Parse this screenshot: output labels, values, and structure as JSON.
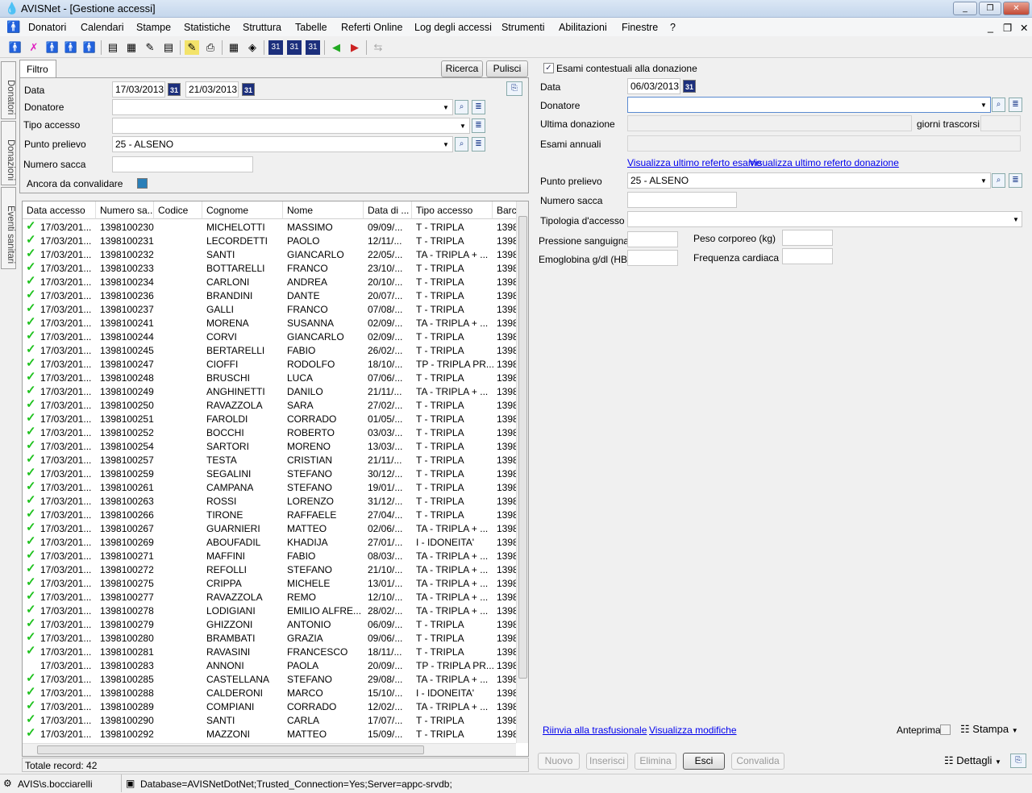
{
  "window": {
    "title": "AVISNet - [Gestione accessi]"
  },
  "menu": [
    "Donatori",
    "Calendari",
    "Stampe",
    "Statistiche",
    "Struttura",
    "Tabelle",
    "Referti Online",
    "Log degli accessi",
    "Strumenti",
    "Abilitazioni",
    "Finestre",
    "?"
  ],
  "side_tabs": [
    "Donatori",
    "Donazioni",
    "Eventi sanitari"
  ],
  "filter": {
    "tab": "Filtro",
    "search": "Ricerca",
    "clear": "Pulisci",
    "data_label": "Data",
    "date_from": "17/03/2013",
    "date_to": "21/03/2013",
    "donatore_label": "Donatore",
    "donatore_value": "",
    "tipo_label": "Tipo accesso",
    "tipo_value": "",
    "punto_label": "Punto prelievo",
    "punto_value": "25 -  ALSENO",
    "sacca_label": "Numero sacca",
    "sacca_value": "",
    "convalidare_label": "Ancora da convalidare"
  },
  "grid": {
    "columns": [
      "Data accesso",
      "Numero sa...",
      "Codice",
      "Cognome",
      "Nome",
      "Data di ...",
      "Tipo accesso",
      "Barc"
    ],
    "rows": [
      [
        true,
        "17/03/201...",
        "1398100230",
        "",
        "MICHELOTTI",
        "MASSIMO",
        "09/09/...",
        "T - TRIPLA",
        "1398"
      ],
      [
        true,
        "17/03/201...",
        "1398100231",
        "",
        "LECORDETTI",
        "PAOLO",
        "12/11/...",
        "T - TRIPLA",
        "1398"
      ],
      [
        true,
        "17/03/201...",
        "1398100232",
        "",
        "SANTI",
        "GIANCARLO",
        "22/05/...",
        "TA - TRIPLA + ...",
        "1398"
      ],
      [
        true,
        "17/03/201...",
        "1398100233",
        "",
        "BOTTARELLI",
        "FRANCO",
        "23/10/...",
        "T - TRIPLA",
        "1398"
      ],
      [
        true,
        "17/03/201...",
        "1398100234",
        "",
        "CARLONI",
        "ANDREA",
        "20/10/...",
        "T - TRIPLA",
        "1398"
      ],
      [
        true,
        "17/03/201...",
        "1398100236",
        "",
        "BRANDINI",
        "DANTE",
        "20/07/...",
        "T - TRIPLA",
        "1398"
      ],
      [
        true,
        "17/03/201...",
        "1398100237",
        "",
        "GALLI",
        "FRANCO",
        "07/08/...",
        "T - TRIPLA",
        "1398"
      ],
      [
        true,
        "17/03/201...",
        "1398100241",
        "",
        "MORENA",
        "SUSANNA",
        "02/09/...",
        "TA - TRIPLA + ...",
        "1398"
      ],
      [
        true,
        "17/03/201...",
        "1398100244",
        "",
        "CORVI",
        "GIANCARLO",
        "02/09/...",
        "T - TRIPLA",
        "1398"
      ],
      [
        true,
        "17/03/201...",
        "1398100245",
        "",
        "BERTARELLI",
        "FABIO",
        "26/02/...",
        "T - TRIPLA",
        "1398"
      ],
      [
        true,
        "17/03/201...",
        "1398100247",
        "",
        "CIOFFI",
        "RODOLFO",
        "18/10/...",
        "TP - TRIPLA PR...",
        "1398"
      ],
      [
        true,
        "17/03/201...",
        "1398100248",
        "",
        "BRUSCHI",
        "LUCA",
        "07/06/...",
        "T - TRIPLA",
        "1398"
      ],
      [
        true,
        "17/03/201...",
        "1398100249",
        "",
        "ANGHINETTI",
        "DANILO",
        "21/11/...",
        "TA - TRIPLA + ...",
        "1398"
      ],
      [
        true,
        "17/03/201...",
        "1398100250",
        "",
        "RAVAZZOLA",
        "SARA",
        "27/02/...",
        "T - TRIPLA",
        "1398"
      ],
      [
        true,
        "17/03/201...",
        "1398100251",
        "",
        "FAROLDI",
        "CORRADO",
        "01/05/...",
        "T - TRIPLA",
        "1398"
      ],
      [
        true,
        "17/03/201...",
        "1398100252",
        "",
        "BOCCHI",
        "ROBERTO",
        "03/03/...",
        "T - TRIPLA",
        "1398"
      ],
      [
        true,
        "17/03/201...",
        "1398100254",
        "",
        "SARTORI",
        "MORENO",
        "13/03/...",
        "T - TRIPLA",
        "1398"
      ],
      [
        true,
        "17/03/201...",
        "1398100257",
        "",
        "TESTA",
        "CRISTIAN",
        "21/11/...",
        "T - TRIPLA",
        "1398"
      ],
      [
        true,
        "17/03/201...",
        "1398100259",
        "",
        "SEGALINI",
        "STEFANO",
        "30/12/...",
        "T - TRIPLA",
        "1398"
      ],
      [
        true,
        "17/03/201...",
        "1398100261",
        "",
        "CAMPANA",
        "STEFANO",
        "19/01/...",
        "T - TRIPLA",
        "1398"
      ],
      [
        true,
        "17/03/201...",
        "1398100263",
        "",
        "ROSSI",
        "LORENZO",
        "31/12/...",
        "T - TRIPLA",
        "1398"
      ],
      [
        true,
        "17/03/201...",
        "1398100266",
        "",
        "TIRONE",
        "RAFFAELE",
        "27/04/...",
        "T - TRIPLA",
        "1398"
      ],
      [
        true,
        "17/03/201...",
        "1398100267",
        "",
        "GUARNIERI",
        "MATTEO",
        "02/06/...",
        "TA - TRIPLA + ...",
        "1398"
      ],
      [
        true,
        "17/03/201...",
        "1398100269",
        "",
        "ABOUFADIL",
        "KHADIJA",
        "27/01/...",
        "I - IDONEITA'",
        "1398"
      ],
      [
        true,
        "17/03/201...",
        "1398100271",
        "",
        "MAFFINI",
        "FABIO",
        "08/03/...",
        "TA - TRIPLA + ...",
        "1398"
      ],
      [
        true,
        "17/03/201...",
        "1398100272",
        "",
        "REFOLLI",
        "STEFANO",
        "21/10/...",
        "TA - TRIPLA + ...",
        "1398"
      ],
      [
        true,
        "17/03/201...",
        "1398100275",
        "",
        "CRIPPA",
        "MICHELE",
        "13/01/...",
        "TA - TRIPLA + ...",
        "1398"
      ],
      [
        true,
        "17/03/201...",
        "1398100277",
        "",
        "RAVAZZOLA",
        "REMO",
        "12/10/...",
        "TA - TRIPLA + ...",
        "1398"
      ],
      [
        true,
        "17/03/201...",
        "1398100278",
        "",
        "LODIGIANI",
        "EMILIO ALFRE...",
        "28/02/...",
        "TA - TRIPLA + ...",
        "1398"
      ],
      [
        true,
        "17/03/201...",
        "1398100279",
        "",
        "GHIZZONI",
        "ANTONIO",
        "06/09/...",
        "T - TRIPLA",
        "1398"
      ],
      [
        true,
        "17/03/201...",
        "1398100280",
        "",
        "BRAMBATI",
        "GRAZIA",
        "09/06/...",
        "T - TRIPLA",
        "1398"
      ],
      [
        true,
        "17/03/201...",
        "1398100281",
        "",
        "RAVASINI",
        "FRANCESCO",
        "18/11/...",
        "T - TRIPLA",
        "1398"
      ],
      [
        false,
        "17/03/201...",
        "1398100283",
        "",
        "ANNONI",
        "PAOLA",
        "20/09/...",
        "TP - TRIPLA PR...",
        "1398"
      ],
      [
        true,
        "17/03/201...",
        "1398100285",
        "",
        "CASTELLANA",
        "STEFANO",
        "29/08/...",
        "TA - TRIPLA + ...",
        "1398"
      ],
      [
        true,
        "17/03/201...",
        "1398100288",
        "",
        "CALDERONI",
        "MARCO",
        "15/10/...",
        "I - IDONEITA'",
        "1398"
      ],
      [
        true,
        "17/03/201...",
        "1398100289",
        "",
        "COMPIANI",
        "CORRADO",
        "12/02/...",
        "TA - TRIPLA + ...",
        "1398"
      ],
      [
        true,
        "17/03/201...",
        "1398100290",
        "",
        "SANTI",
        "CARLA",
        "17/07/...",
        "T - TRIPLA",
        "1398"
      ],
      [
        true,
        "17/03/201...",
        "1398100292",
        "",
        "MAZZONI",
        "MATTEO",
        "15/09/...",
        "T - TRIPLA",
        "1398"
      ]
    ],
    "total": "Totale record: 42"
  },
  "detail": {
    "esami_label": "Esami contestuali alla donazione",
    "esami_checked": true,
    "data_label": "Data",
    "data_value": "06/03/2013",
    "donatore_label": "Donatore",
    "donatore_value": "",
    "ultima_label": "Ultima donazione",
    "giorni_label": "giorni trascorsi",
    "esami_annuali_label": "Esami annuali",
    "link_esame": "Visualizza ultimo referto esame",
    "link_donazione": "Visualizza ultimo referto donazione",
    "punto_label": "Punto prelievo",
    "punto_value": "25 -  ALSENO",
    "sacca_label": "Numero sacca",
    "tipologia_label": "Tipologia d'accesso",
    "pressione_label": "Pressione sanguigna",
    "peso_label": "Peso corporeo (kg)",
    "emoglobina_label": "Emoglobina g/dl (HB)",
    "frequenza_label": "Frequenza cardiaca",
    "link_riinvia": "Riinvia alla trasfusionale",
    "link_modifiche": "Visualizza modifiche",
    "anteprima_label": "Anteprima",
    "stampa": "Stampa",
    "dettagli": "Dettagli",
    "buttons": {
      "nuovo": "Nuovo",
      "inserisci": "Inserisci",
      "elimina": "Elimina",
      "esci": "Esci",
      "convalida": "Convalida"
    }
  },
  "status": {
    "user": "AVIS\\s.bocciarelli",
    "connection": "Database=AVISNetDotNet;Trusted_Connection=Yes;Server=appc-srvdb;"
  }
}
